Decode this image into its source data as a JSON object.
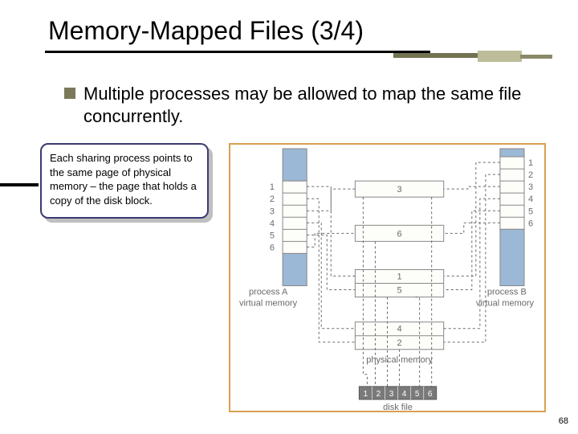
{
  "title": "Memory-Mapped Files (3/4)",
  "bullet": "Multiple processes may be allowed to map the same file concurrently.",
  "callout": "Each sharing process points to the same page of physical memory – the page that holds a copy of the disk block.",
  "diagram": {
    "procA_label": "process A virtual memory",
    "procB_label": "process B virtual memory",
    "phys_label": "physical memory",
    "disk_label": "disk file",
    "procA_pages": [
      "1",
      "2",
      "3",
      "4",
      "5",
      "6"
    ],
    "procB_pages": [
      "1",
      "2",
      "3",
      "4",
      "5",
      "6"
    ],
    "phys_blocks": [
      [
        "3"
      ],
      [
        "6"
      ],
      [
        "1",
        "5"
      ],
      [
        "4",
        "2"
      ]
    ],
    "disk_blocks": [
      "1",
      "2",
      "3",
      "4",
      "5",
      "6"
    ]
  },
  "page_number": "68"
}
